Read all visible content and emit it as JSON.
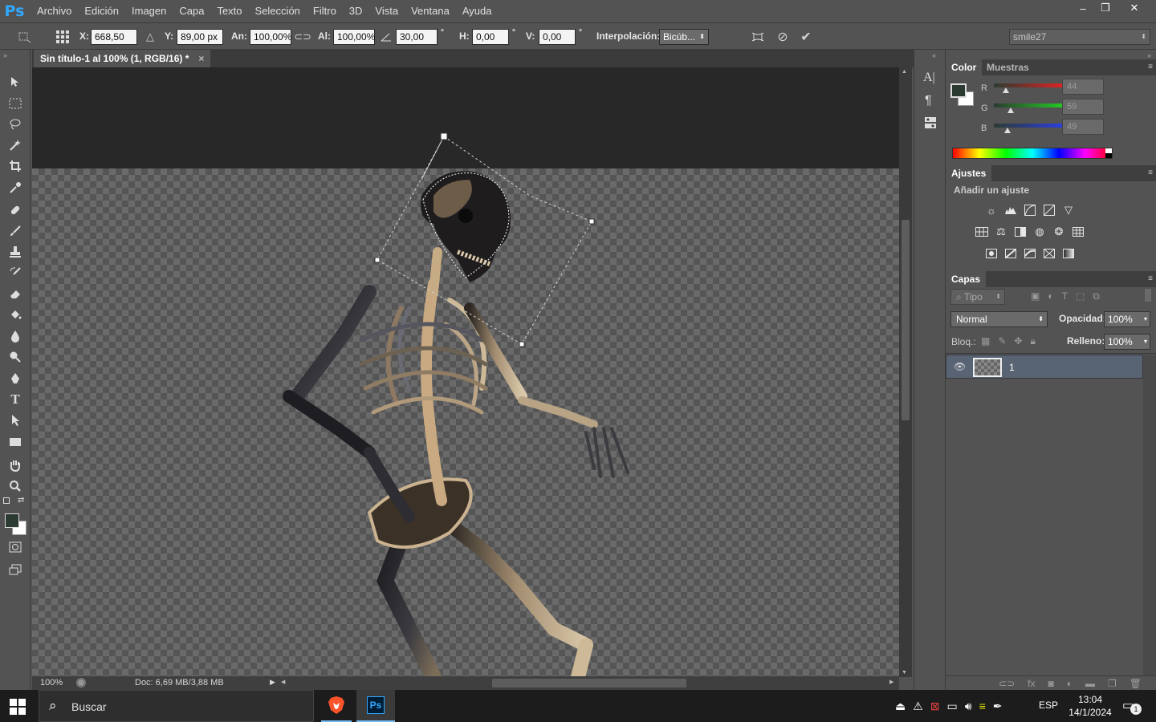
{
  "app": {
    "logo": "Ps"
  },
  "menu": [
    "Archivo",
    "Edición",
    "Imagen",
    "Capa",
    "Texto",
    "Selección",
    "Filtro",
    "3D",
    "Vista",
    "Ventana",
    "Ayuda"
  ],
  "window_controls": {
    "minimize": "–",
    "restore": "❐",
    "close": "✕"
  },
  "options": {
    "x_label": "X:",
    "x_value": "668,50 px",
    "y_label": "Y:",
    "y_value": "89,00 px",
    "w_label": "An:",
    "w_value": "100,00%",
    "h_label": "Al:",
    "h_value": "100,00%",
    "angle_value": "30,00",
    "degree": "°",
    "hskew_label": "H:",
    "hskew_value": "0,00",
    "vskew_label": "V:",
    "vskew_value": "0,00",
    "interp_label": "Interpolación:",
    "interp_value": "Bicúb...",
    "workspace": "smile27"
  },
  "document": {
    "tab_title": "Sin título-1 al 100% (1, RGB/16) *",
    "close": "×"
  },
  "status": {
    "zoom": "100%",
    "doc_info": "Doc: 6,69 MB/3,88 MB"
  },
  "color_panel": {
    "tabs": [
      "Color",
      "Muestras"
    ],
    "channels": [
      {
        "label": "R",
        "value": "44",
        "pos": 0.17,
        "color": "#e52222"
      },
      {
        "label": "G",
        "value": "59",
        "pos": 0.23,
        "color": "#22d022"
      },
      {
        "label": "B",
        "value": "49",
        "pos": 0.19,
        "color": "#2a3ee8"
      }
    ],
    "foreground": "#2c3b31",
    "background": "#ffffff"
  },
  "adjustments_panel": {
    "tab": "Ajustes",
    "heading": "Añadir un ajuste"
  },
  "layers_panel": {
    "tab": "Capas",
    "filter_placeholder": "Tipo",
    "blend_mode": "Normal",
    "opacity_label": "Opacidad:",
    "opacity_value": "100%",
    "lock_label": "Bloq.:",
    "fill_label": "Relleno:",
    "fill_value": "100%",
    "layers": [
      {
        "name": "1"
      }
    ]
  },
  "taskbar": {
    "search_placeholder": "Buscar",
    "language": "ESP",
    "time": "13:04",
    "date": "14/1/2024",
    "notification_count": "1"
  }
}
